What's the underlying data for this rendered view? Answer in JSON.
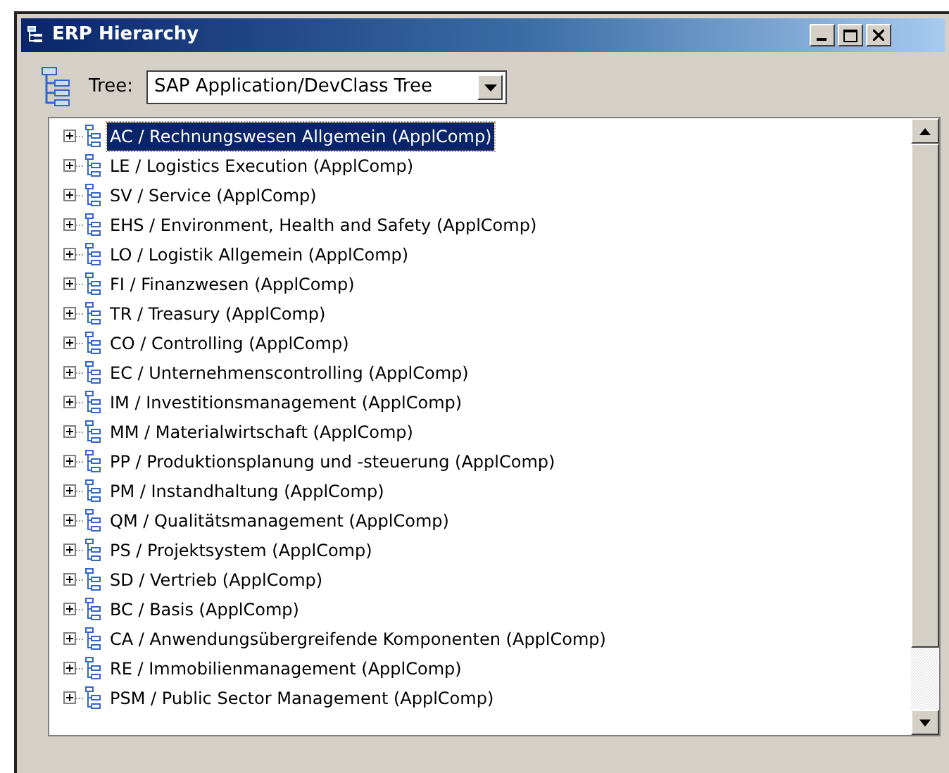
{
  "window": {
    "title": "ERP Hierarchy"
  },
  "tree_selector": {
    "label": "Tree:",
    "value": "SAP Application/DevClass Tree"
  },
  "tree": {
    "items": [
      {
        "label": "AC / Rechnungswesen Allgemein (ApplComp)",
        "selected": true,
        "expanded": false
      },
      {
        "label": "LE / Logistics Execution (ApplComp)",
        "selected": false,
        "expanded": false
      },
      {
        "label": "SV / Service (ApplComp)",
        "selected": false,
        "expanded": false
      },
      {
        "label": "EHS / Environment, Health and Safety (ApplComp)",
        "selected": false,
        "expanded": false
      },
      {
        "label": "LO / Logistik Allgemein (ApplComp)",
        "selected": false,
        "expanded": false
      },
      {
        "label": "FI / Finanzwesen (ApplComp)",
        "selected": false,
        "expanded": false
      },
      {
        "label": "TR / Treasury (ApplComp)",
        "selected": false,
        "expanded": false
      },
      {
        "label": "CO / Controlling (ApplComp)",
        "selected": false,
        "expanded": false
      },
      {
        "label": "EC / Unternehmenscontrolling (ApplComp)",
        "selected": false,
        "expanded": false
      },
      {
        "label": "IM / Investitionsmanagement (ApplComp)",
        "selected": false,
        "expanded": false
      },
      {
        "label": "MM / Materialwirtschaft (ApplComp)",
        "selected": false,
        "expanded": false
      },
      {
        "label": "PP / Produktionsplanung und -steuerung (ApplComp)",
        "selected": false,
        "expanded": false
      },
      {
        "label": "PM / Instandhaltung (ApplComp)",
        "selected": false,
        "expanded": false
      },
      {
        "label": "QM / Qualitätsmanagement (ApplComp)",
        "selected": false,
        "expanded": false
      },
      {
        "label": "PS / Projektsystem (ApplComp)",
        "selected": false,
        "expanded": false
      },
      {
        "label": "SD / Vertrieb (ApplComp)",
        "selected": false,
        "expanded": false
      },
      {
        "label": "BC / Basis (ApplComp)",
        "selected": false,
        "expanded": false
      },
      {
        "label": "CA / Anwendungsübergreifende Komponenten (ApplComp)",
        "selected": false,
        "expanded": false
      },
      {
        "label": "RE / Immobilienmanagement (ApplComp)",
        "selected": false,
        "expanded": false
      },
      {
        "label": "PSM / Public Sector Management (ApplComp)",
        "selected": false,
        "expanded": false
      }
    ]
  }
}
